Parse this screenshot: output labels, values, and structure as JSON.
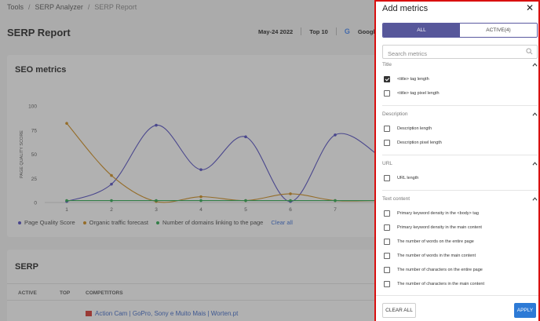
{
  "breadcrumb": [
    "Tools",
    "SERP Analyzer",
    "SERP Report"
  ],
  "page_title": "SERP Report",
  "report_meta": {
    "date": "May-24 2022",
    "top": "Top 10",
    "engine": "Google",
    "locale_partial": "L"
  },
  "seo_metrics": {
    "title": "SEO metrics",
    "legend": [
      "Page Quality Score",
      "Organic traffic forecast",
      "Number of domains linking to the page"
    ],
    "clear_all": "Clear all",
    "colors": {
      "page_quality": "#4f49c2",
      "organic": "#cf8a16",
      "domains": "#26a84a"
    }
  },
  "chart_data": {
    "type": "line",
    "x": [
      1,
      2,
      3,
      4,
      5,
      6,
      7,
      8
    ],
    "ylabel": "PAGE QUALITY SCORE",
    "ylim": [
      0,
      100
    ],
    "yticks": [
      0,
      25,
      50,
      75,
      100
    ],
    "x_visible": [
      1,
      2,
      3,
      4,
      5,
      6,
      7
    ],
    "series": [
      {
        "name": "Page Quality Score",
        "values": [
          1,
          19,
          80,
          34,
          68,
          1,
          70,
          48
        ]
      },
      {
        "name": "Organic traffic forecast",
        "values": [
          82,
          28,
          1,
          6,
          2,
          9,
          2,
          2
        ]
      },
      {
        "name": "Number of domains linking to the page",
        "values": [
          2,
          2,
          2,
          2,
          2,
          2,
          2,
          2
        ]
      }
    ]
  },
  "serp": {
    "title": "SERP",
    "columns": [
      "ACTIVE",
      "TOP",
      "COMPETITORS"
    ],
    "first_row": "Action Cam | GoPro, Sony e Muito Mais | Worten.pt"
  },
  "panel": {
    "title": "Add metrics",
    "tabs": [
      "ALL",
      "ACTIVE(4)"
    ],
    "search_placeholder": "Search metrics",
    "sections": [
      {
        "title": "Title",
        "items": [
          {
            "label": "<title> tag length",
            "checked": true
          },
          {
            "label": "<title> tag pixel length",
            "checked": false
          }
        ]
      },
      {
        "title": "Description",
        "items": [
          {
            "label": "Description length",
            "checked": false
          },
          {
            "label": "Description pixel length",
            "checked": false
          }
        ]
      },
      {
        "title": "URL",
        "items": [
          {
            "label": "URL length",
            "checked": false
          }
        ]
      },
      {
        "title": "Text content",
        "items": [
          {
            "label": "Primary keyword density in the <body> tag",
            "checked": false
          },
          {
            "label": "Primary keyword density in the main content",
            "checked": false
          },
          {
            "label": "The number of words on the entire page",
            "checked": false
          },
          {
            "label": "The number of words in the main content",
            "checked": false
          },
          {
            "label": "The number of characters on the entire page",
            "checked": false
          },
          {
            "label": "The number of characters in the main content",
            "checked": false
          }
        ]
      }
    ],
    "clear_all": "CLEAR ALL",
    "apply": "APPLY"
  }
}
